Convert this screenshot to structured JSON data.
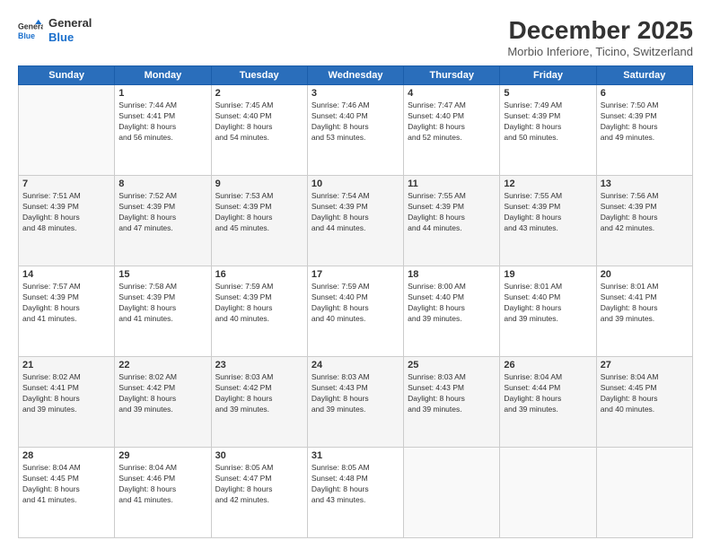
{
  "logo": {
    "line1": "General",
    "line2": "Blue"
  },
  "title": "December 2025",
  "subtitle": "Morbio Inferiore, Ticino, Switzerland",
  "days_of_week": [
    "Sunday",
    "Monday",
    "Tuesday",
    "Wednesday",
    "Thursday",
    "Friday",
    "Saturday"
  ],
  "weeks": [
    [
      {
        "day": "",
        "info": ""
      },
      {
        "day": "1",
        "info": "Sunrise: 7:44 AM\nSunset: 4:41 PM\nDaylight: 8 hours\nand 56 minutes."
      },
      {
        "day": "2",
        "info": "Sunrise: 7:45 AM\nSunset: 4:40 PM\nDaylight: 8 hours\nand 54 minutes."
      },
      {
        "day": "3",
        "info": "Sunrise: 7:46 AM\nSunset: 4:40 PM\nDaylight: 8 hours\nand 53 minutes."
      },
      {
        "day": "4",
        "info": "Sunrise: 7:47 AM\nSunset: 4:40 PM\nDaylight: 8 hours\nand 52 minutes."
      },
      {
        "day": "5",
        "info": "Sunrise: 7:49 AM\nSunset: 4:39 PM\nDaylight: 8 hours\nand 50 minutes."
      },
      {
        "day": "6",
        "info": "Sunrise: 7:50 AM\nSunset: 4:39 PM\nDaylight: 8 hours\nand 49 minutes."
      }
    ],
    [
      {
        "day": "7",
        "info": "Sunrise: 7:51 AM\nSunset: 4:39 PM\nDaylight: 8 hours\nand 48 minutes."
      },
      {
        "day": "8",
        "info": "Sunrise: 7:52 AM\nSunset: 4:39 PM\nDaylight: 8 hours\nand 47 minutes."
      },
      {
        "day": "9",
        "info": "Sunrise: 7:53 AM\nSunset: 4:39 PM\nDaylight: 8 hours\nand 45 minutes."
      },
      {
        "day": "10",
        "info": "Sunrise: 7:54 AM\nSunset: 4:39 PM\nDaylight: 8 hours\nand 44 minutes."
      },
      {
        "day": "11",
        "info": "Sunrise: 7:55 AM\nSunset: 4:39 PM\nDaylight: 8 hours\nand 44 minutes."
      },
      {
        "day": "12",
        "info": "Sunrise: 7:55 AM\nSunset: 4:39 PM\nDaylight: 8 hours\nand 43 minutes."
      },
      {
        "day": "13",
        "info": "Sunrise: 7:56 AM\nSunset: 4:39 PM\nDaylight: 8 hours\nand 42 minutes."
      }
    ],
    [
      {
        "day": "14",
        "info": "Sunrise: 7:57 AM\nSunset: 4:39 PM\nDaylight: 8 hours\nand 41 minutes."
      },
      {
        "day": "15",
        "info": "Sunrise: 7:58 AM\nSunset: 4:39 PM\nDaylight: 8 hours\nand 41 minutes."
      },
      {
        "day": "16",
        "info": "Sunrise: 7:59 AM\nSunset: 4:39 PM\nDaylight: 8 hours\nand 40 minutes."
      },
      {
        "day": "17",
        "info": "Sunrise: 7:59 AM\nSunset: 4:40 PM\nDaylight: 8 hours\nand 40 minutes."
      },
      {
        "day": "18",
        "info": "Sunrise: 8:00 AM\nSunset: 4:40 PM\nDaylight: 8 hours\nand 39 minutes."
      },
      {
        "day": "19",
        "info": "Sunrise: 8:01 AM\nSunset: 4:40 PM\nDaylight: 8 hours\nand 39 minutes."
      },
      {
        "day": "20",
        "info": "Sunrise: 8:01 AM\nSunset: 4:41 PM\nDaylight: 8 hours\nand 39 minutes."
      }
    ],
    [
      {
        "day": "21",
        "info": "Sunrise: 8:02 AM\nSunset: 4:41 PM\nDaylight: 8 hours\nand 39 minutes."
      },
      {
        "day": "22",
        "info": "Sunrise: 8:02 AM\nSunset: 4:42 PM\nDaylight: 8 hours\nand 39 minutes."
      },
      {
        "day": "23",
        "info": "Sunrise: 8:03 AM\nSunset: 4:42 PM\nDaylight: 8 hours\nand 39 minutes."
      },
      {
        "day": "24",
        "info": "Sunrise: 8:03 AM\nSunset: 4:43 PM\nDaylight: 8 hours\nand 39 minutes."
      },
      {
        "day": "25",
        "info": "Sunrise: 8:03 AM\nSunset: 4:43 PM\nDaylight: 8 hours\nand 39 minutes."
      },
      {
        "day": "26",
        "info": "Sunrise: 8:04 AM\nSunset: 4:44 PM\nDaylight: 8 hours\nand 39 minutes."
      },
      {
        "day": "27",
        "info": "Sunrise: 8:04 AM\nSunset: 4:45 PM\nDaylight: 8 hours\nand 40 minutes."
      }
    ],
    [
      {
        "day": "28",
        "info": "Sunrise: 8:04 AM\nSunset: 4:45 PM\nDaylight: 8 hours\nand 41 minutes."
      },
      {
        "day": "29",
        "info": "Sunrise: 8:04 AM\nSunset: 4:46 PM\nDaylight: 8 hours\nand 41 minutes."
      },
      {
        "day": "30",
        "info": "Sunrise: 8:05 AM\nSunset: 4:47 PM\nDaylight: 8 hours\nand 42 minutes."
      },
      {
        "day": "31",
        "info": "Sunrise: 8:05 AM\nSunset: 4:48 PM\nDaylight: 8 hours\nand 43 minutes."
      },
      {
        "day": "",
        "info": ""
      },
      {
        "day": "",
        "info": ""
      },
      {
        "day": "",
        "info": ""
      }
    ]
  ]
}
